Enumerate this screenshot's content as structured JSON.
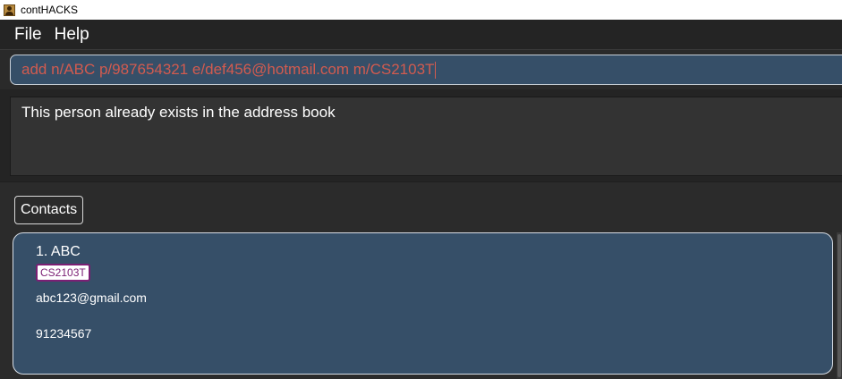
{
  "window": {
    "title": "contHACKS"
  },
  "menu": {
    "items": [
      "File",
      "Help"
    ]
  },
  "command": {
    "value": "add n/ABC p/987654321 e/def456@hotmail.com m/CS2103T"
  },
  "result": {
    "message": "This person already exists in the address book"
  },
  "contacts_button": {
    "label": "Contacts"
  },
  "contacts": [
    {
      "name": "1. ABC",
      "tags": [
        "CS2103T"
      ],
      "email": "abc123@gmail.com",
      "phone": "91234567"
    }
  ],
  "colors": {
    "card": "#364f68",
    "command_text": "#d25b4f",
    "tag_text": "#7b1f74",
    "background": "#242424"
  }
}
